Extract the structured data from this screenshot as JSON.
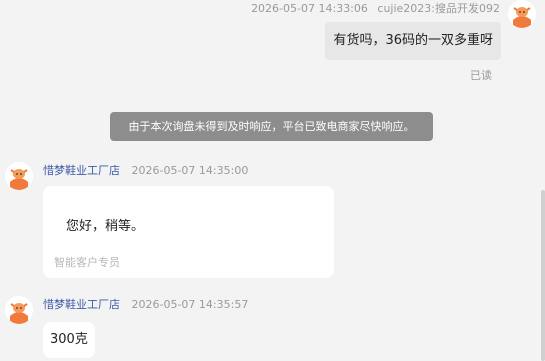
{
  "messages": {
    "outgoing": {
      "timestamp": "2026-05-07 14:33:06",
      "sender": "cujie2023:搜品开发092",
      "text": "有货吗，36码的一双多重呀",
      "status": "已读"
    },
    "system_notice": "由于本次询盘未得到及时响应，平台已致电商家尽快响应。",
    "reply1": {
      "shop": "惜梦鞋业工厂店",
      "timestamp": "2026-05-07 14:35:00",
      "text": "您好，稍等。",
      "tag": "智能客户专员"
    },
    "reply2": {
      "shop": "惜梦鞋业工厂店",
      "timestamp": "2026-05-07 14:35:57",
      "text": "300克"
    }
  },
  "colors": {
    "background": "#f3f3f3",
    "outgoing_bubble": "#e7e7e7",
    "incoming_bubble": "#ffffff",
    "shop_name": "#3d5aa8",
    "notice_bg": "#8d8d8d",
    "avatar_accent": "#f07a3c"
  },
  "icons": {
    "avatar": "cartoon-cow-avatar-icon"
  }
}
